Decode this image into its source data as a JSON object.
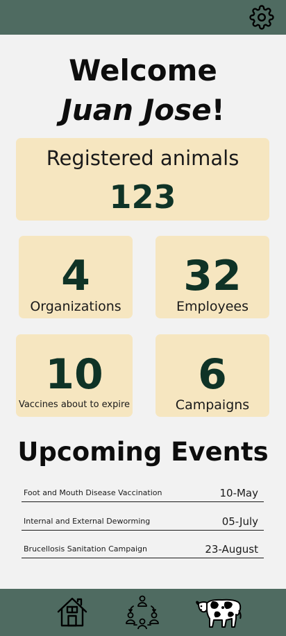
{
  "header": {
    "settings_icon": "gear-icon"
  },
  "welcome": {
    "greeting": "Welcome",
    "name": "Juan Jose",
    "exclaim": "!"
  },
  "stats": {
    "registered": {
      "label": "Registered animals",
      "value": "123"
    },
    "organizations": {
      "label": "Organizations",
      "value": "4"
    },
    "employees": {
      "label": "Employees",
      "value": "32"
    },
    "vaccines": {
      "label": "Vaccines about to expire",
      "value": "10"
    },
    "campaigns": {
      "label": "Campaigns",
      "value": "6"
    }
  },
  "events": {
    "title": "Upcoming Events",
    "items": [
      {
        "name": "Foot and Mouth Disease Vaccination",
        "date": "10-May"
      },
      {
        "name": "Internal and External Deworming",
        "date": "05-July"
      },
      {
        "name": "Brucellosis Sanitation Campaign",
        "date": "23-August"
      }
    ]
  },
  "nav": {
    "icons": [
      "home-icon",
      "organization-icon",
      "cow-icon"
    ]
  },
  "colors": {
    "bar": "#4f6b61",
    "card": "#f6e6c0",
    "accent": "#0f3326",
    "background": "#f2f2f2"
  }
}
